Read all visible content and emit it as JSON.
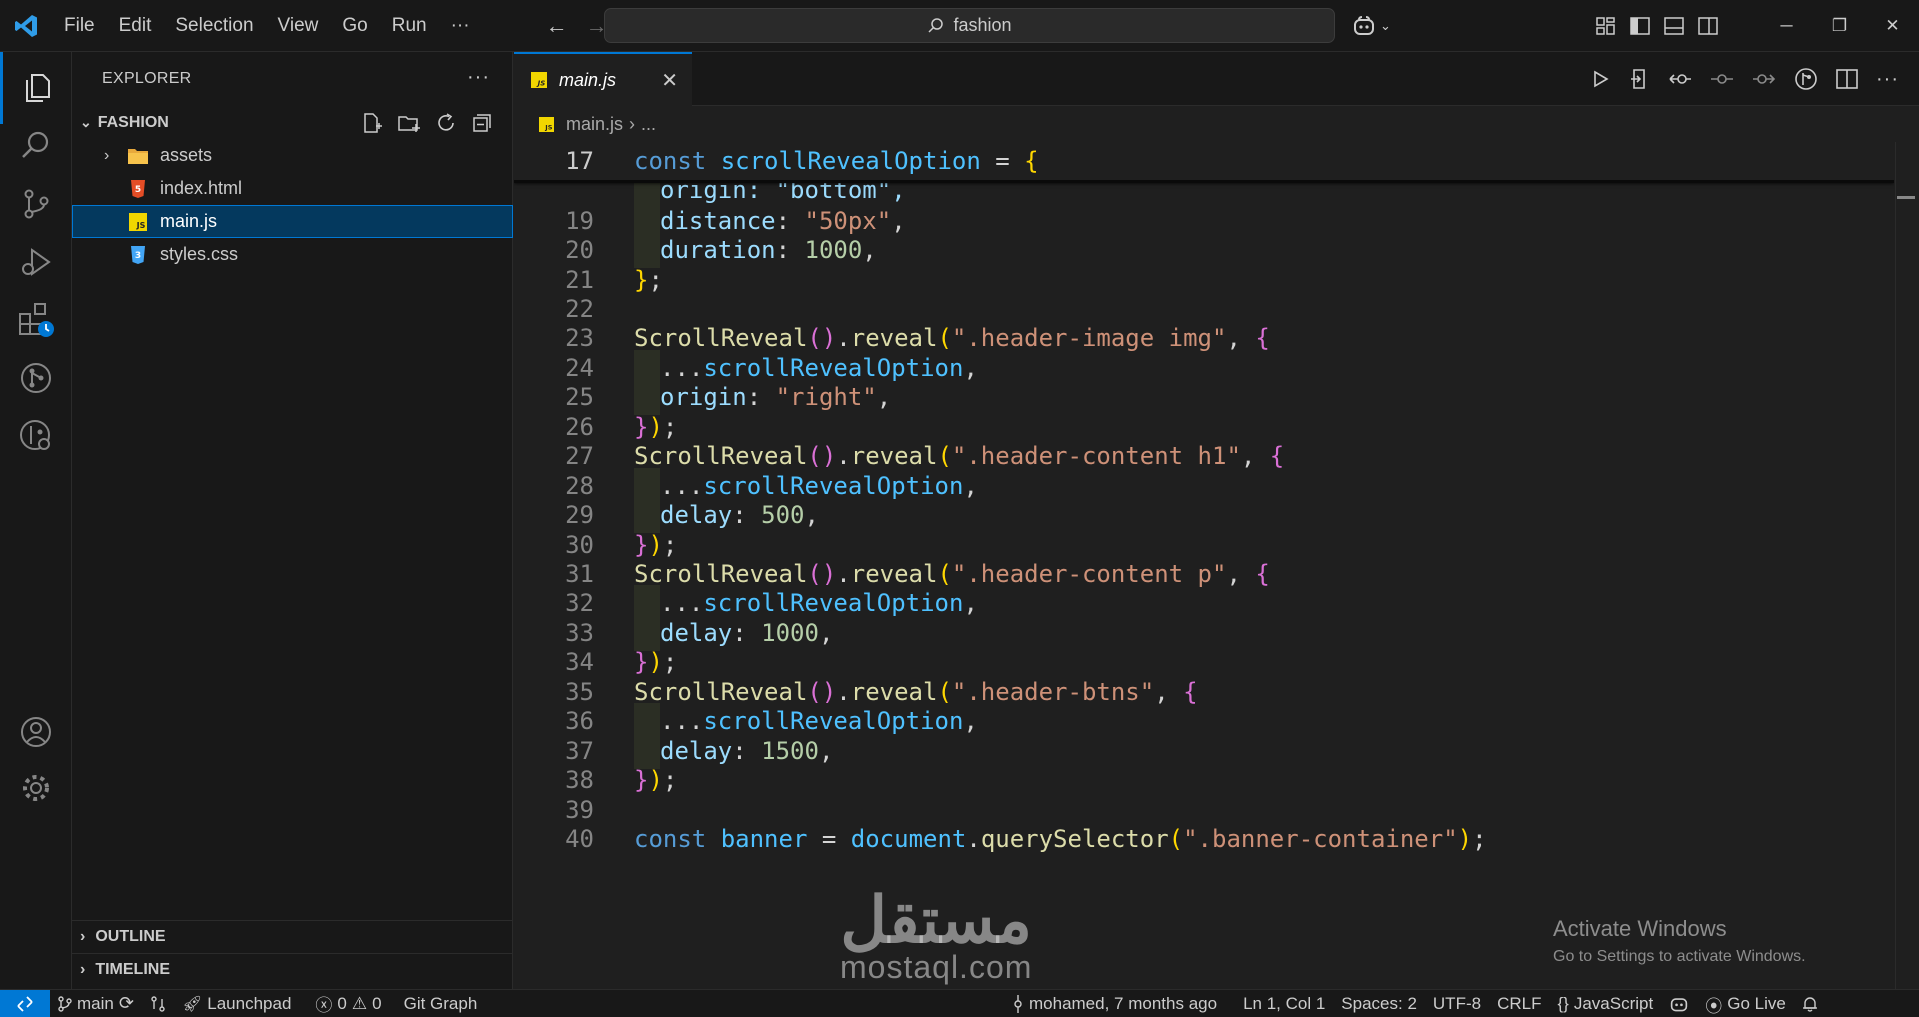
{
  "titlebar": {
    "menu": [
      "File",
      "Edit",
      "Selection",
      "View",
      "Go",
      "Run",
      "···"
    ],
    "search_text": "fashion",
    "window_controls": [
      "minimize-icon",
      "restore-icon",
      "close-icon"
    ]
  },
  "activitybar": {
    "items": [
      "explorer-icon",
      "search-icon",
      "source-control-icon",
      "run-debug-icon",
      "extensions-icon",
      "git-graph-icon",
      "gitlens-icon"
    ],
    "bottom": [
      "accounts-icon",
      "settings-gear-icon"
    ]
  },
  "sidebar": {
    "title": "EXPLORER",
    "more": "···",
    "folder": "FASHION",
    "tree": [
      {
        "name": "assets",
        "type": "folder"
      },
      {
        "name": "index.html",
        "type": "html"
      },
      {
        "name": "main.js",
        "type": "js",
        "selected": true
      },
      {
        "name": "styles.css",
        "type": "css"
      }
    ],
    "outline": "OUTLINE",
    "timeline": "TIMELINE"
  },
  "editor": {
    "tab_label": "main.js",
    "breadcrumb_file": "main.js",
    "breadcrumb_rest": "...",
    "sticky_line": "17",
    "lines": [
      {
        "n": "17"
      },
      {
        "n": "19"
      },
      {
        "n": "20"
      },
      {
        "n": "21"
      },
      {
        "n": "22"
      },
      {
        "n": "23"
      },
      {
        "n": "24"
      },
      {
        "n": "25"
      },
      {
        "n": "26"
      },
      {
        "n": "27"
      },
      {
        "n": "28"
      },
      {
        "n": "29"
      },
      {
        "n": "30"
      },
      {
        "n": "31"
      },
      {
        "n": "32"
      },
      {
        "n": "33"
      },
      {
        "n": "34"
      },
      {
        "n": "35"
      },
      {
        "n": "36"
      },
      {
        "n": "37"
      },
      {
        "n": "38"
      },
      {
        "n": "39"
      },
      {
        "n": "40"
      }
    ],
    "code": {
      "l17_kw": "const",
      "l17_var": "scrollRevealOption",
      "l17_rest": " = ",
      "l18_partial": "origin: \"bottom\",",
      "l19_prop": "distance",
      "l19_val": "\"50px\"",
      "l20_prop": "duration",
      "l20_val": "1000",
      "l21": "};",
      "l23_sel": "\".header-image img\"",
      "spread": "...",
      "spread_var": "scrollRevealOption",
      "l25_prop": "origin",
      "l25_val": "\"right\"",
      "close_call": "});",
      "fn": "ScrollReveal",
      "method": "reveal",
      "l27_sel": "\".header-content h1\"",
      "l29_prop": "delay",
      "l29_val": "500",
      "l31_sel": "\".header-content p\"",
      "l33_val": "1000",
      "l35_sel": "\".header-btns\"",
      "l37_val": "1500",
      "l40_var": "banner",
      "l40_obj": "document",
      "l40_method": "querySelector",
      "l40_sel": "\".banner-container\""
    }
  },
  "overlay": {
    "activate_title": "Activate Windows",
    "activate_sub": "Go to Settings to activate Windows.",
    "watermark_ar": "مستقل",
    "watermark_en": "mostaql.com"
  },
  "statusbar": {
    "branch": "main",
    "launchpad": "Launchpad",
    "errors": "0",
    "warnings": "0",
    "git_graph": "Git Graph",
    "blame": "mohamed, 7 months ago",
    "position": "Ln 1, Col 1",
    "spaces": "Spaces: 2",
    "encoding": "UTF-8",
    "eol": "CRLF",
    "language": "JavaScript",
    "golive": "Go Live"
  },
  "colors": {
    "accent": "#0078d4",
    "keyword": "#569cd6",
    "string": "#ce9178",
    "function": "#dcdcaa",
    "number": "#b5cea8"
  }
}
